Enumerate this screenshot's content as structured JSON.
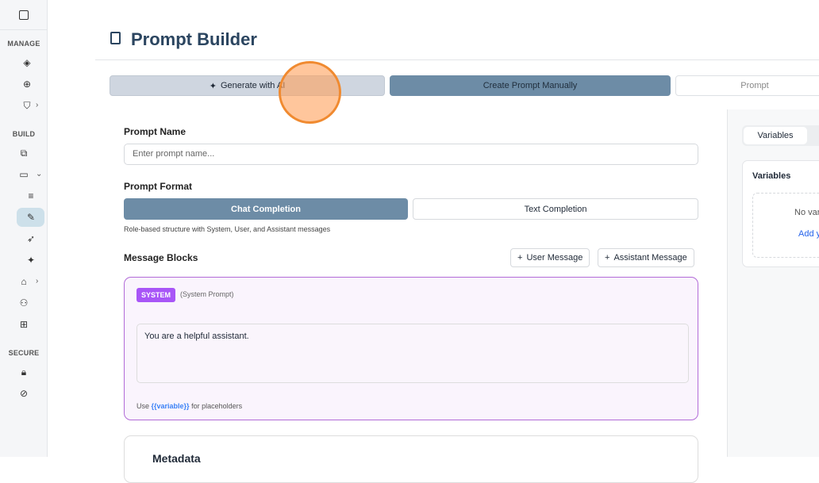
{
  "sidebar": {
    "sections": [
      "MANAGE",
      "BUILD",
      "SECURE"
    ]
  },
  "header": {
    "title": "Prompt Builder"
  },
  "mode_tabs": [
    "Generate with AI",
    "Create Prompt Manually",
    "Prompt"
  ],
  "form": {
    "name_label": "Prompt Name",
    "name_placeholder": "Enter prompt name...",
    "format_label": "Prompt Format",
    "formats": [
      "Chat Completion",
      "Text Completion"
    ],
    "format_hint": "Role-based structure with System, User, and Assistant messages",
    "blocks_label": "Message Blocks",
    "add_user": "User Message",
    "add_assistant": "Assistant Message",
    "system_block": {
      "badge": "SYSTEM",
      "subtitle": "(System Prompt)",
      "content": "You are a helpful assistant.",
      "hint_prefix": "Use ",
      "hint_var": "{{variable}}",
      "hint_suffix": " for placeholders"
    },
    "metadata_label": "Metadata"
  },
  "right_panel": {
    "tab": "Variables",
    "card_title": "Variables",
    "empty": "No var",
    "add": "Add y"
  }
}
